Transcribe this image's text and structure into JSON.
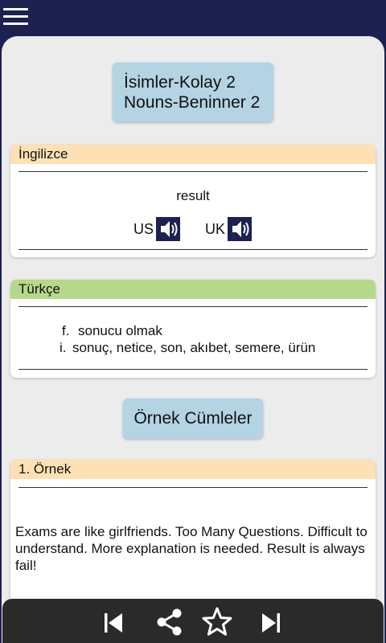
{
  "top_bar": {
    "menu_icon": "hamburger-menu-icon"
  },
  "title": {
    "line1": "İsimler-Kolay 2",
    "line2": "Nouns-Beninner 2"
  },
  "english_card": {
    "header": "İngilizce",
    "word": "result",
    "us_label": "US",
    "uk_label": "UK",
    "speaker_icon": "speaker-icon"
  },
  "turkish_card": {
    "header": "Türkçe",
    "meanings": [
      {
        "marker": "f.",
        "text": "sonucu olmak"
      },
      {
        "marker": "i.",
        "text": "sonuç, netice, son, akıbet, semere, ürün"
      }
    ]
  },
  "examples_button": {
    "label": "Örnek Cümleler"
  },
  "example_card": {
    "header": "1. Örnek",
    "text": "Exams are like girlfriends. Too Many Questions. Difficult to understand. More explanation is needed. Result is always fail!"
  },
  "bottom_bar": {
    "icons": [
      "skip-previous-icon",
      "share-icon",
      "star-icon",
      "skip-next-icon"
    ]
  },
  "colors": {
    "top_bar": "#1c2150",
    "content_bg": "#ececec",
    "title_box": "#b4d3e3",
    "orange_header": "#fde1b4",
    "green_header": "#b6d88a",
    "bottom_bar": "#2a2a2a"
  }
}
